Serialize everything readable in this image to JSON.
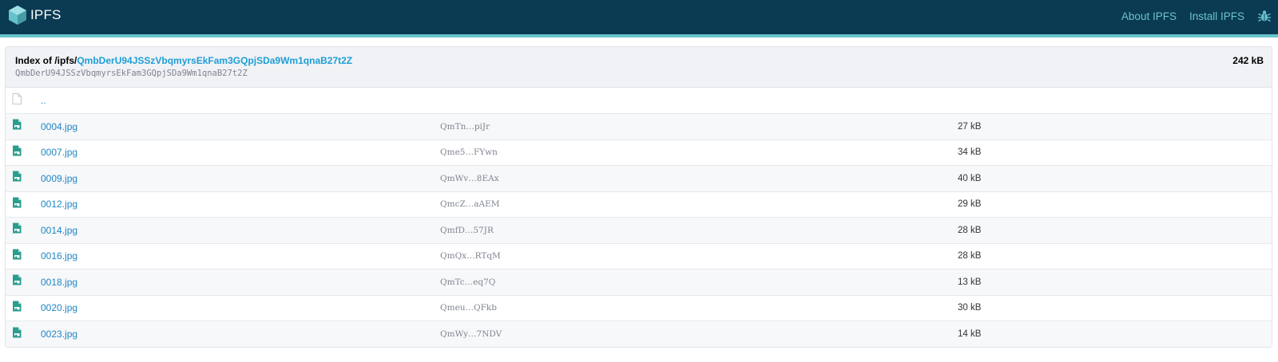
{
  "header": {
    "logo_text": "IPFS",
    "nav": [
      {
        "label": "About IPFS"
      },
      {
        "label": "Install IPFS"
      }
    ]
  },
  "listing": {
    "index_prefix": "Index of /ipfs/",
    "path_hash": "QmbDerU94JSSzVbqmyrsEkFam3GQpjSDa9Wm1qnaB27t2Z",
    "cid": "QmbDerU94JSSzVbqmyrsEkFam3GQpjSDa9Wm1qnaB27t2Z",
    "total_size": "242 kB",
    "parent_label": "..",
    "rows": [
      {
        "name": "0004.jpg",
        "hash": "QmTn…piJr",
        "size": "27 kB"
      },
      {
        "name": "0007.jpg",
        "hash": "Qme5…FYwn",
        "size": "34 kB"
      },
      {
        "name": "0009.jpg",
        "hash": "QmWv…8EAx",
        "size": "40 kB"
      },
      {
        "name": "0012.jpg",
        "hash": "QmcZ…aAEM",
        "size": "29 kB"
      },
      {
        "name": "0014.jpg",
        "hash": "QmfD…57JR",
        "size": "28 kB"
      },
      {
        "name": "0016.jpg",
        "hash": "QmQx…RTqM",
        "size": "28 kB"
      },
      {
        "name": "0018.jpg",
        "hash": "QmTc…eq7Q",
        "size": "13 kB"
      },
      {
        "name": "0020.jpg",
        "hash": "Qmeu…QFkb",
        "size": "30 kB"
      },
      {
        "name": "0023.jpg",
        "hash": "QmWy…7NDV",
        "size": "14 kB"
      }
    ]
  },
  "colors": {
    "topbar": "#0b3a53",
    "accent": "#69c4cd",
    "link": "#1f86c2",
    "hash_link": "#1f9ed6",
    "file_icon": "#2a9d8f"
  }
}
